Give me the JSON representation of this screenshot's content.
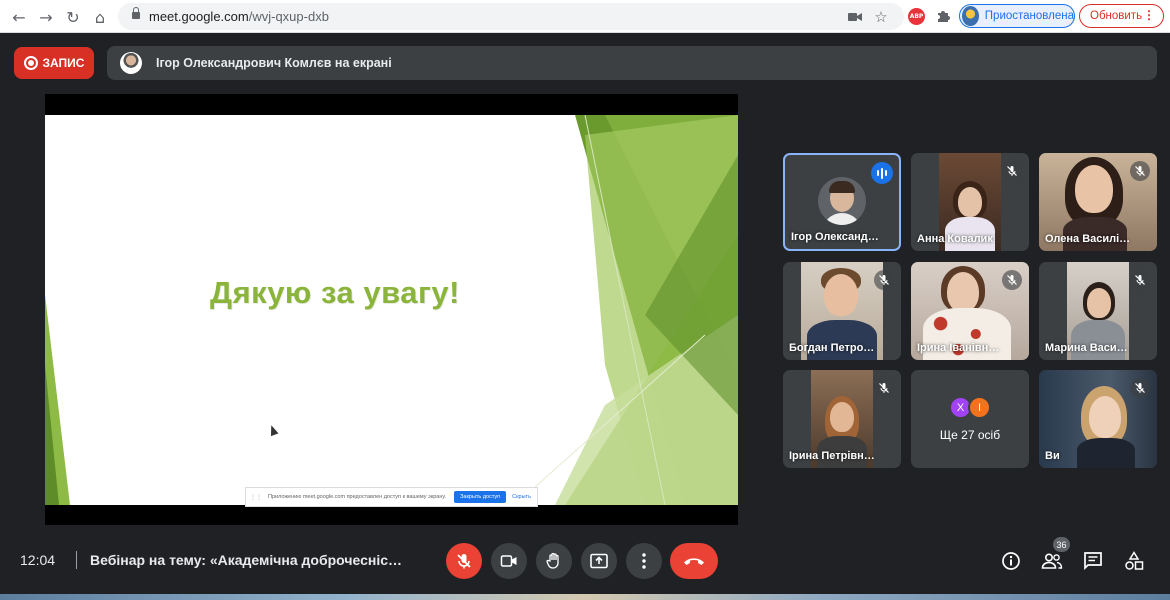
{
  "browser": {
    "url_host": "meet.google.com",
    "url_path": "/wvj-qxup-dxb",
    "profile_label": "Приостановлена",
    "update_label": "Обновить",
    "abp_label": "ABP"
  },
  "banner": {
    "record_label": "ЗАПИС",
    "presenting_text": "Ігор Олександрович Комлєв на екрані"
  },
  "slide": {
    "title": "Дякую за увагу!",
    "share_notice": "Приложению meet.google.com предоставлен доступ к вашему экрану.",
    "stop_share_label": "Закрыть доступ",
    "hide_label": "Скрыть"
  },
  "participants": [
    {
      "name": "Ігор Олександ…"
    },
    {
      "name": "Анна Ковалик"
    },
    {
      "name": "Олена Василі…"
    },
    {
      "name": "Богдан Петро…"
    },
    {
      "name": "Ірина Іванівн…"
    },
    {
      "name": "Марина Васи…"
    },
    {
      "name": "Ірина Петрівн…"
    },
    {
      "name": "Ще 27 осіб",
      "initials": [
        "Х",
        "І"
      ]
    },
    {
      "name": "Ви"
    }
  ],
  "footer": {
    "time": "12:04",
    "meeting_title": "Вебінар на тему: «Академічна доброчесніс…",
    "participants_count": "36"
  },
  "colors": {
    "danger": "#ea4335",
    "accent": "#1a73e8",
    "slide_green": "#8ab43a"
  }
}
